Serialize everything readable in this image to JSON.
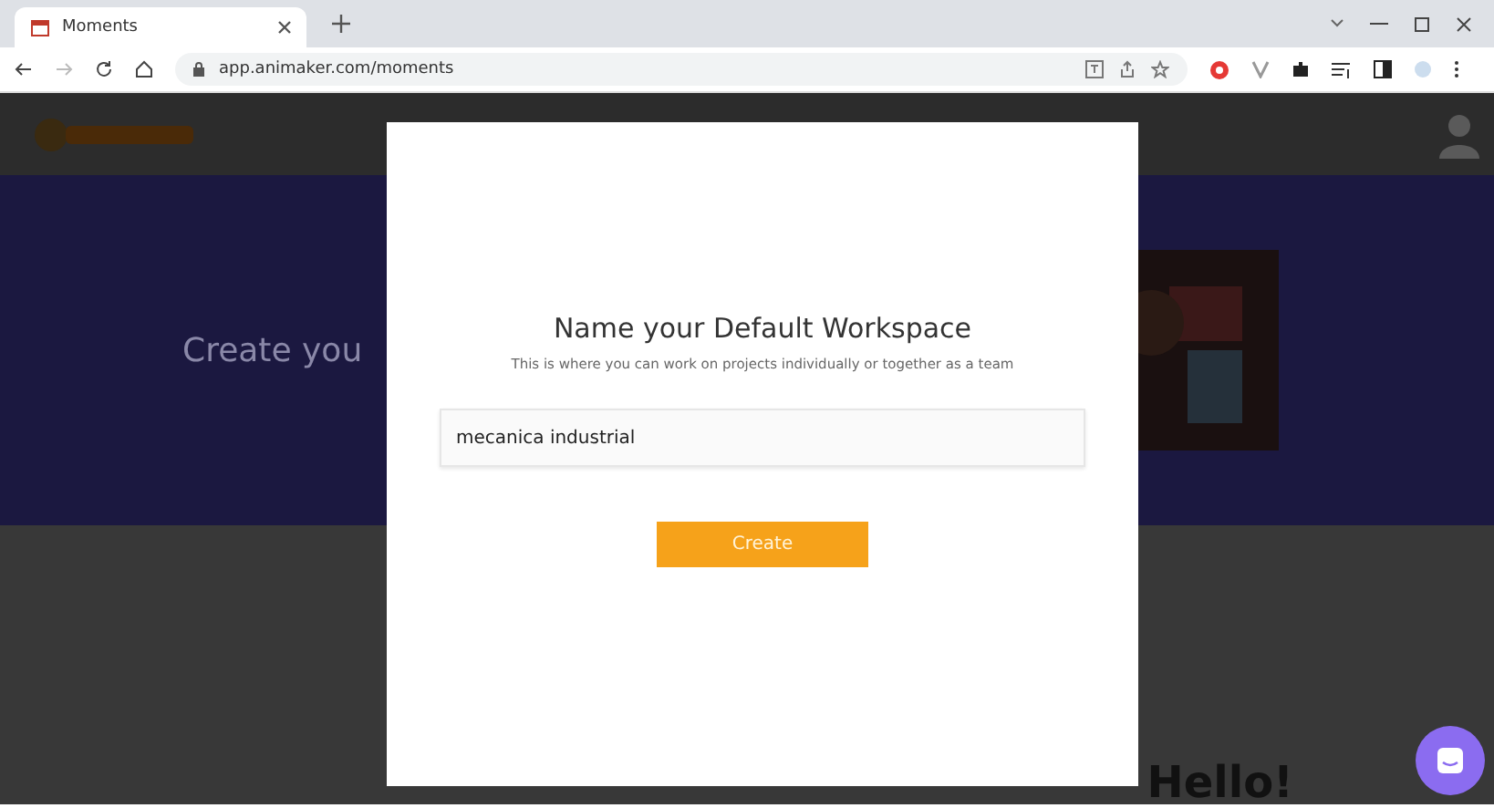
{
  "browser": {
    "tab": {
      "title": "Moments"
    },
    "address": "app.animaker.com/moments"
  },
  "page": {
    "hero_title": "Create you",
    "promo_title": "Hello!"
  },
  "dialog": {
    "title": "Name your Default Workspace",
    "subtitle": "This is where you can work on projects individually or together as a team",
    "field": {
      "value": "mecanica industrial"
    },
    "button": "Create"
  }
}
